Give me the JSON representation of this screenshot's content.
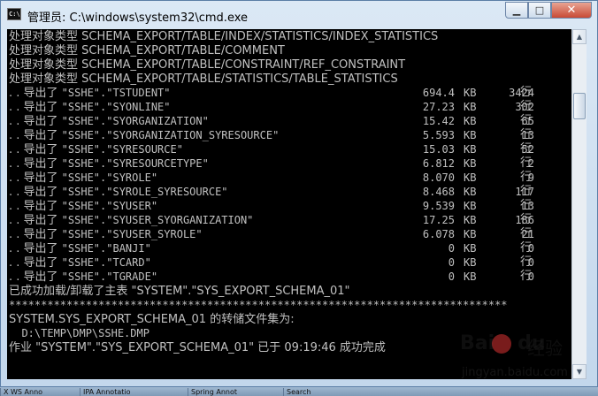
{
  "window": {
    "title": "管理员: C:\\windows\\system32\\cmd.exe",
    "icon_text": "C:\\"
  },
  "console": {
    "header_lines": [
      "处理对象类型 SCHEMA_EXPORT/TABLE/INDEX/STATISTICS/INDEX_STATISTICS",
      "处理对象类型 SCHEMA_EXPORT/TABLE/COMMENT",
      "处理对象类型 SCHEMA_EXPORT/TABLE/CONSTRAINT/REF_CONSTRAINT",
      "处理对象类型 SCHEMA_EXPORT/TABLE/STATISTICS/TABLE_STATISTICS"
    ],
    "export_rows": [
      {
        "prefix": ". . 导出了 ",
        "table": "\"SSHE\".\"TSTUDENT\"",
        "size": "694.4",
        "unit": "KB",
        "rows": "3424",
        "suffix": "行"
      },
      {
        "prefix": ". . 导出了 ",
        "table": "\"SSHE\".\"SYONLINE\"",
        "size": "27.23",
        "unit": "KB",
        "rows": "302",
        "suffix": "行"
      },
      {
        "prefix": ". . 导出了 ",
        "table": "\"SSHE\".\"SYORGANIZATION\"",
        "size": "15.42",
        "unit": "KB",
        "rows": "65",
        "suffix": "行"
      },
      {
        "prefix": ". . 导出了 ",
        "table": "\"SSHE\".\"SYORGANIZATION_SYRESOURCE\"",
        "size": "5.593",
        "unit": "KB",
        "rows": "13",
        "suffix": "行"
      },
      {
        "prefix": ". . 导出了 ",
        "table": "\"SSHE\".\"SYRESOURCE\"",
        "size": "15.03",
        "unit": "KB",
        "rows": "52",
        "suffix": "行"
      },
      {
        "prefix": ". . 导出了 ",
        "table": "\"SSHE\".\"SYRESOURCETYPE\"",
        "size": "6.812",
        "unit": "KB",
        "rows": "2",
        "suffix": "行"
      },
      {
        "prefix": ". . 导出了 ",
        "table": "\"SSHE\".\"SYROLE\"",
        "size": "8.070",
        "unit": "KB",
        "rows": "9",
        "suffix": "行"
      },
      {
        "prefix": ". . 导出了 ",
        "table": "\"SSHE\".\"SYROLE_SYRESOURCE\"",
        "size": "8.468",
        "unit": "KB",
        "rows": "117",
        "suffix": "行"
      },
      {
        "prefix": ". . 导出了 ",
        "table": "\"SSHE\".\"SYUSER\"",
        "size": "9.539",
        "unit": "KB",
        "rows": "13",
        "suffix": "行"
      },
      {
        "prefix": ". . 导出了 ",
        "table": "\"SSHE\".\"SYUSER_SYORGANIZATION\"",
        "size": "17.25",
        "unit": "KB",
        "rows": "186",
        "suffix": "行"
      },
      {
        "prefix": ". . 导出了 ",
        "table": "\"SSHE\".\"SYUSER_SYROLE\"",
        "size": "6.078",
        "unit": "KB",
        "rows": "21",
        "suffix": "行"
      },
      {
        "prefix": ". . 导出了 ",
        "table": "\"SSHE\".\"BANJI\"",
        "size": "0",
        "unit": "KB",
        "rows": "0",
        "suffix": "行"
      },
      {
        "prefix": ". . 导出了 ",
        "table": "\"SSHE\".\"TCARD\"",
        "size": "0",
        "unit": "KB",
        "rows": "0",
        "suffix": "行"
      },
      {
        "prefix": ". . 导出了 ",
        "table": "\"SSHE\".\"TGRADE\"",
        "size": "0",
        "unit": "KB",
        "rows": "0",
        "suffix": "行"
      }
    ],
    "master_table_line": "已成功加载/卸载了主表 \"SYSTEM\".\"SYS_EXPORT_SCHEMA_01\"",
    "separator": "******************************************************************************",
    "dump_set_line": "SYSTEM.SYS_EXPORT_SCHEMA_01 的转储文件集为:",
    "dump_path_line": "  D:\\TEMP\\DMP\\SSHE.DMP",
    "job_done_line": "作业 \"SYSTEM\".\"SYS_EXPORT_SCHEMA_01\" 已于 09:19:46 成功完成"
  },
  "taskbar": {
    "items": [
      "X WS Anno",
      "IPA Annotatio",
      "Spring Annot",
      "Search"
    ]
  },
  "watermark": {
    "brand": "Bai",
    "brand_suffix": "du",
    "cn": "经验",
    "url": "jingyan.baidu.com"
  }
}
